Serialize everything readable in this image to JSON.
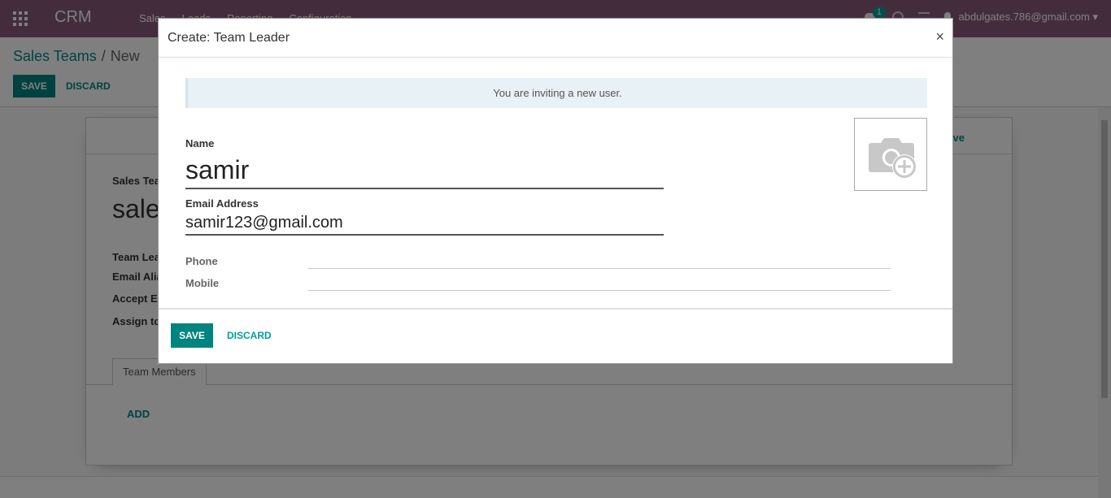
{
  "navbar": {
    "brand": "CRM",
    "menu": [
      "Sales",
      "Leads",
      "Reporting",
      "Configuration"
    ],
    "chat_badge": "1",
    "user_email": "abdulgates.786@gmail.com"
  },
  "control_panel": {
    "breadcrumb_parent": "Sales Teams",
    "breadcrumb_separator": "/",
    "breadcrumb_current": "New",
    "save_label": "SAVE",
    "discard_label": "DISCARD"
  },
  "form": {
    "archive_label": "ve",
    "sales_team_label": "Sales Tea",
    "title_partial": "sale",
    "labels": [
      "Team Lea",
      "Email Alia",
      "Accept Er",
      "Assign to"
    ],
    "tab_label": "Team Members",
    "add_label": "ADD"
  },
  "modal": {
    "title": "Create: Team Leader",
    "close_symbol": "×",
    "alert_text": "You are inviting a new user.",
    "name_label": "Name",
    "name_value": "samir",
    "email_label": "Email Address",
    "email_value": "samir123@gmail.com",
    "phone_label": "Phone",
    "phone_value": "",
    "mobile_label": "Mobile",
    "mobile_value": "",
    "save_label": "SAVE",
    "discard_label": "DISCARD"
  },
  "colors": {
    "navbar": "#875a7b",
    "primary": "#00847f",
    "link": "#008784"
  }
}
